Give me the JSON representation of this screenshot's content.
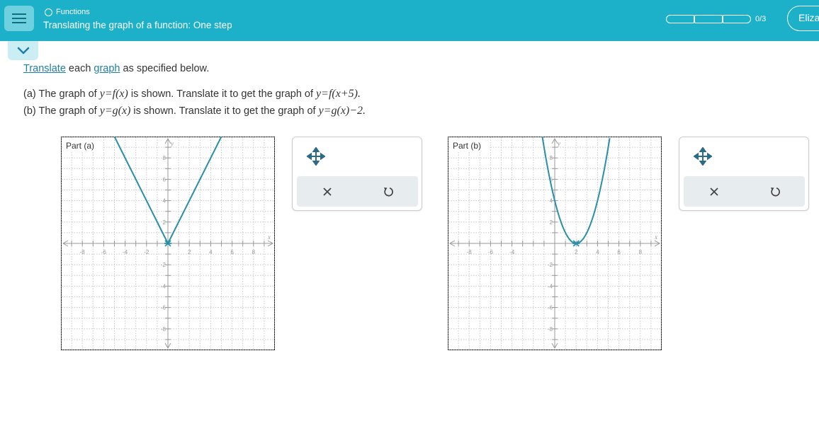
{
  "header": {
    "topic": "Functions",
    "title": "Translating the graph of a function: One step",
    "progress_text": "0/3",
    "user_name": "Eliza"
  },
  "instructions": {
    "link1": "Translate",
    "text1": " each ",
    "link2": "graph",
    "text2": " as specified below."
  },
  "problems": {
    "a": {
      "prefix": "(a) The graph of ",
      "func": "y=f(x)",
      "middle": " is shown. Translate it to get the graph of ",
      "target": "y=f(x+5)."
    },
    "b": {
      "prefix": "(b) The graph of ",
      "func": "y=g(x)",
      "middle": " is shown. Translate it to get the graph of ",
      "target": "y=g(x)−2."
    }
  },
  "graphs": [
    {
      "id": "a",
      "label": "Part (a)",
      "x_axis_label": "x",
      "y_axis_label": "y",
      "x_range": [
        -10,
        10
      ],
      "y_range": [
        -10,
        10
      ],
      "x_ticks": [
        "-8",
        "-6",
        "-4",
        "-2",
        "2",
        "4",
        "6",
        "8"
      ],
      "y_ticks": [
        "8",
        "6",
        "4",
        "2",
        "-2",
        "-4",
        "-6",
        "-8"
      ],
      "function": "absolute",
      "vertex": [
        0,
        0
      ],
      "slope": 2
    },
    {
      "id": "b",
      "label": "Part (b)",
      "x_axis_label": "x",
      "y_axis_label": "y",
      "x_range": [
        -10,
        10
      ],
      "y_range": [
        -10,
        10
      ],
      "x_ticks": [
        "-8",
        "-6",
        "-4",
        "2",
        "4",
        "6",
        "8"
      ],
      "y_ticks": [
        "8",
        "6",
        "4",
        "2",
        "-2",
        "-4",
        "-6",
        "-8"
      ],
      "function": "parabola",
      "vertex": [
        2,
        0
      ],
      "coefficient": 1
    }
  ],
  "colors": {
    "header": "#1cb0c9",
    "curve": "#2a8fa8",
    "link": "#1d7fa8"
  },
  "icons": [
    "menu-icon",
    "circle-icon",
    "chevron-down-icon",
    "move-icon",
    "close-icon",
    "undo-icon"
  ]
}
